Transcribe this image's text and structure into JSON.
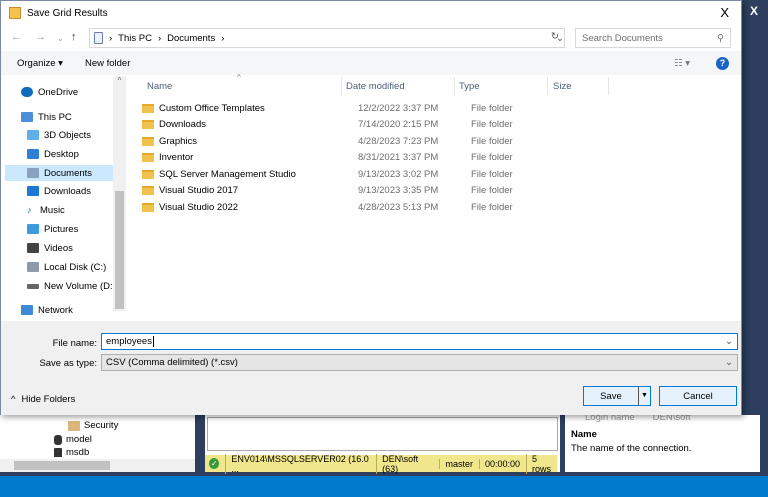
{
  "dialog": {
    "title": "Save Grid Results",
    "close": "X",
    "breadcrumb": [
      "This PC",
      "Documents"
    ],
    "search_placeholder": "Search Documents",
    "toolbar": {
      "organize": "Organize ▾",
      "new_folder": "New folder",
      "help": "?"
    },
    "nav": [
      "OneDrive",
      "This PC",
      "3D Objects",
      "Desktop",
      "Documents",
      "Downloads",
      "Music",
      "Pictures",
      "Videos",
      "Local Disk (C:)",
      "New Volume (D:",
      "Network"
    ],
    "columns": [
      "Name",
      "Date modified",
      "Type",
      "Size"
    ],
    "files": [
      {
        "name": "Custom Office Templates",
        "date": "12/2/2022 3:37 PM",
        "type": "File folder"
      },
      {
        "name": "Downloads",
        "date": "7/14/2020 2:15 PM",
        "type": "File folder"
      },
      {
        "name": "Graphics",
        "date": "4/28/2023 7:23 PM",
        "type": "File folder"
      },
      {
        "name": "Inventor",
        "date": "8/31/2021 3:37 PM",
        "type": "File folder"
      },
      {
        "name": "SQL Server Management Studio",
        "date": "9/13/2023 3:02 PM",
        "type": "File folder"
      },
      {
        "name": "Visual Studio 2017",
        "date": "9/13/2023 3:35 PM",
        "type": "File folder"
      },
      {
        "name": "Visual Studio 2022",
        "date": "4/28/2023 5:13 PM",
        "type": "File folder"
      }
    ],
    "file_name_label": "File name:",
    "file_name": "employees",
    "save_type_label": "Save as type:",
    "save_type": "CSV (Comma delimited) (*.csv)",
    "hide_folders": "Hide Folders",
    "save": "Save",
    "cancel": "Cancel"
  },
  "background": {
    "tree": [
      "Security",
      "model",
      "msdb"
    ],
    "status": [
      "ENV014\\MSSQLSERVER02 (16.0 ...",
      "DEN\\soft (63)",
      "master",
      "00:00:00",
      "5 rows"
    ],
    "props": {
      "login_name": "Login name",
      "login_value": "DEN\\soft",
      "heading": "Name",
      "desc": "The name of the connection."
    },
    "close": "X"
  },
  "colors": {
    "accent": "#0078d7",
    "status_bar": "#f0e68c",
    "taskbar": "#007acc"
  }
}
